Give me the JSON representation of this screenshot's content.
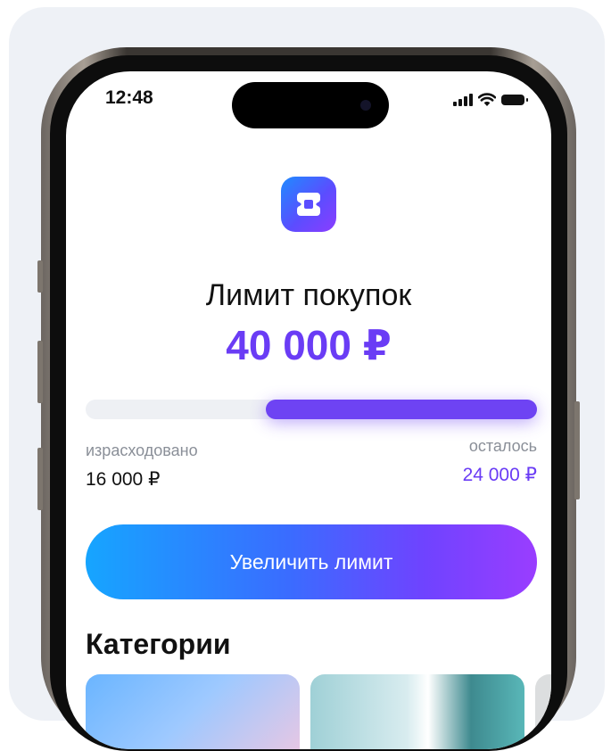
{
  "status_bar": {
    "time": "12:48",
    "icons": [
      "signal-icon",
      "wifi-icon",
      "battery-icon"
    ]
  },
  "app": {
    "logo_icon": "app-logo-icon",
    "brand_colors": {
      "accent": "#6a3cf5",
      "gradient_start": "#16a5ff",
      "gradient_end": "#9a3dff"
    }
  },
  "limit": {
    "title": "Лимит покупок",
    "amount": "40 000 ₽",
    "spent_fraction": 0.4
  },
  "spent": {
    "label": "израсходовано",
    "value": "16 000 ₽"
  },
  "remaining": {
    "label": "осталось",
    "value": "24 000 ₽"
  },
  "cta": {
    "label": "Увеличить лимит"
  },
  "categories": {
    "title": "Категории"
  }
}
